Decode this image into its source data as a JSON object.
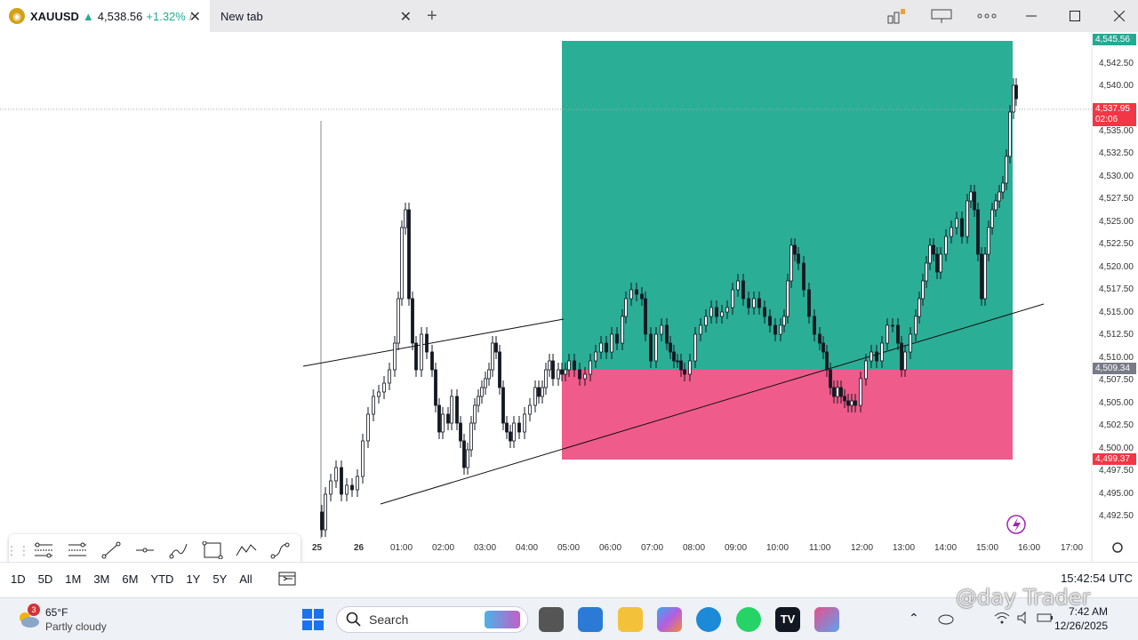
{
  "browser": {
    "active_tab": {
      "symbol": "XAUUSD",
      "arrow": "▲",
      "price": "4,538.56",
      "change": "+1.32%",
      "sep": "/"
    },
    "new_tab_label": "New tab",
    "close_glyph": "✕",
    "plus_glyph": "+"
  },
  "chart": {
    "price_axis": [
      "4,542.50",
      "4,540.00",
      "4,535.00",
      "4,532.50",
      "4,530.00",
      "4,527.50",
      "4,525.00",
      "4,522.50",
      "4,520.00",
      "4,517.50",
      "4,515.00",
      "4,512.50",
      "4,510.00",
      "4,507.50",
      "4,505.00",
      "4,502.50",
      "4,500.00",
      "4,497.50",
      "4,495.00",
      "4,492.50"
    ],
    "badges": {
      "top": "4,545.56",
      "current_price": "4,537.95",
      "countdown": "02:06",
      "mid": "4,509.34",
      "bottom": "4,499.37"
    },
    "time_axis": [
      "12:00",
      "13:00",
      "14:00",
      "15:00",
      "16:00",
      "17:00",
      "25",
      "26",
      "01:00",
      "02:00",
      "03:00",
      "04:00",
      "05:00",
      "06:00",
      "07:00",
      "08:00",
      "09:00",
      "10:00",
      "11:00",
      "12:00",
      "13:00",
      "14:00",
      "15:00",
      "16:00",
      "17:00"
    ],
    "colors": {
      "up": "#22ab94",
      "target": "#2bae96",
      "stop": "#ef5b8a",
      "badge_top": "#22ab94",
      "badge_price": "#f23645",
      "badge_mid": "#787b86",
      "badge_bottom": "#f23645"
    }
  },
  "drawing_toolbar": [
    "long-position-icon",
    "short-position-icon",
    "trend-line-icon",
    "horizontal-ray-icon",
    "brush-icon",
    "rectangle-icon",
    "path-icon",
    "curve-icon"
  ],
  "bottombar": {
    "ranges": [
      "1D",
      "5D",
      "1M",
      "3M",
      "6M",
      "YTD",
      "1Y",
      "5Y",
      "All"
    ],
    "clock": "15:42:54 UTC"
  },
  "taskbar": {
    "weather_temp": "65°F",
    "weather_desc": "Partly cloudy",
    "weather_badge": "3",
    "search_label": "Search",
    "time": "7:42 AM",
    "date": "12/26/2025"
  },
  "watermark": "@day Trader"
}
